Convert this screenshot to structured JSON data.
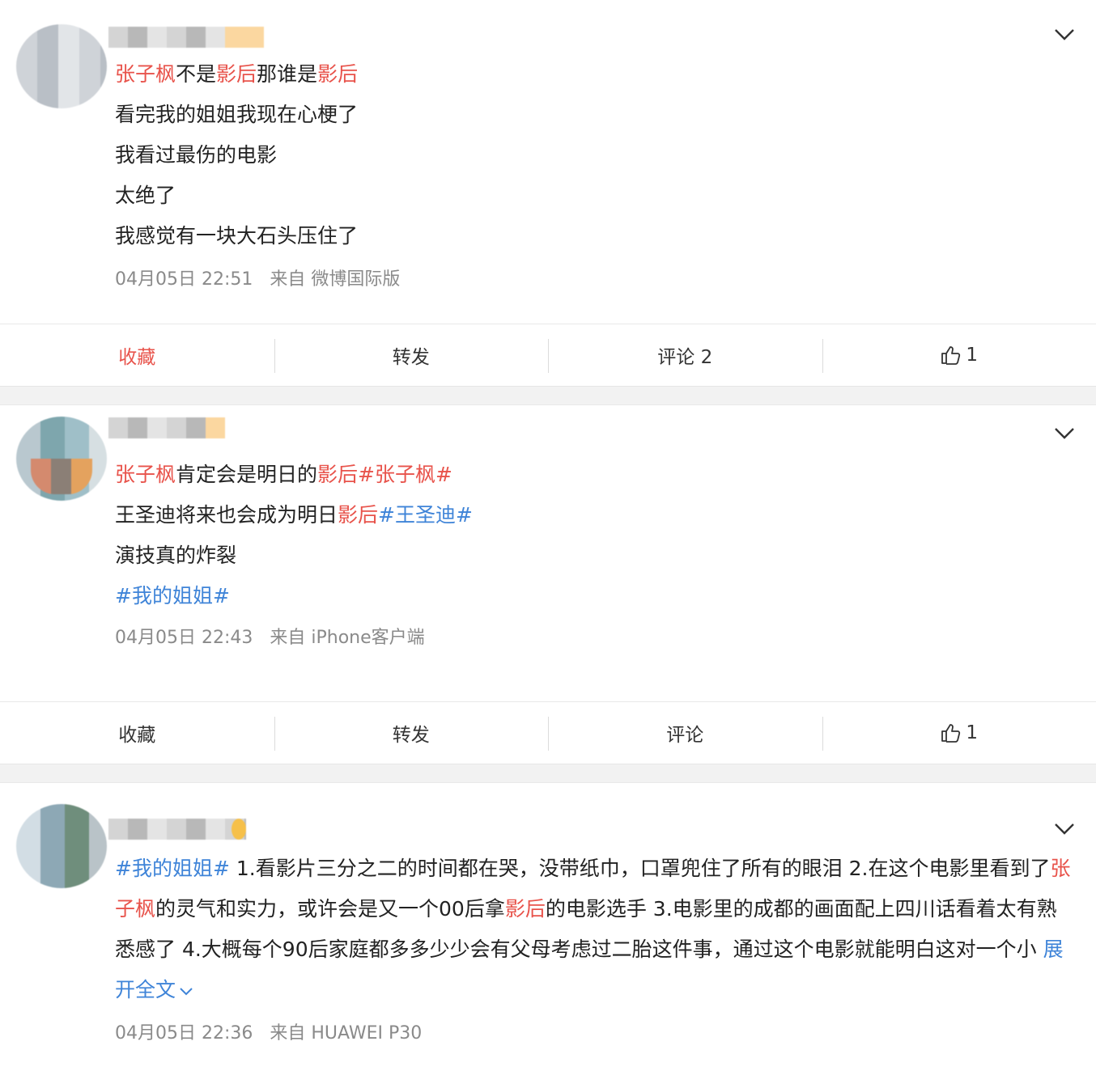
{
  "posts": [
    {
      "lines": [
        [
          {
            "t": "张子枫",
            "c": "red"
          },
          {
            "t": "不是"
          },
          {
            "t": "影后",
            "c": "red"
          },
          {
            "t": "那谁是"
          },
          {
            "t": "影后",
            "c": "red"
          }
        ],
        [
          {
            "t": "看完我的姐姐我现在心梗了"
          }
        ],
        [
          {
            "t": "我看过最伤的电影"
          }
        ],
        [
          {
            "t": "太绝了"
          }
        ],
        [
          {
            "t": "我感觉有一块大石头压住了"
          }
        ]
      ],
      "date": "04月05日 22:51",
      "source": "来自 微博国际版",
      "actions": {
        "favorite": "收藏",
        "repost": "转发",
        "comment": "评论 2",
        "like_count": "1"
      }
    },
    {
      "lines": [
        [
          {
            "t": "张子枫",
            "c": "red"
          },
          {
            "t": "肯定会是明日的"
          },
          {
            "t": "影后",
            "c": "red"
          },
          {
            "t": "#张子枫#",
            "c": "red"
          }
        ],
        [
          {
            "t": "王圣迪将来也会成为明日"
          },
          {
            "t": "影后",
            "c": "red"
          },
          {
            "t": "#王圣迪#",
            "c": "blue"
          }
        ],
        [
          {
            "t": "演技真的炸裂"
          }
        ],
        [
          {
            "t": "#我的姐姐#",
            "c": "blue"
          }
        ]
      ],
      "date": "04月05日 22:43",
      "source": "来自 iPhone客户端",
      "actions": {
        "favorite": "收藏",
        "repost": "转发",
        "comment": "评论",
        "like_count": "1"
      }
    },
    {
      "lines": [
        [
          {
            "t": "#我的姐姐#",
            "c": "blue"
          },
          {
            "t": " 1.看影片三分之二的时间都在哭，没带纸巾，口罩兜住了所有的眼泪 2.在这个电影里看到了"
          },
          {
            "t": "张子枫",
            "c": "red"
          },
          {
            "t": "的灵气和实力，或许会是又一个00后拿"
          },
          {
            "t": "影后",
            "c": "red"
          },
          {
            "t": "的电影选手 3.电影里的成都的画面配上四川话看着太有熟悉感了 4.大概每个90后家庭都多多少少会有父母考虑过二胎这件事，通过这个电影就能明白这对一个小 "
          }
        ]
      ],
      "expand": "展开全文",
      "date": "04月05日 22:36",
      "source": "来自 HUAWEI P30"
    }
  ],
  "colors": {
    "highlight_red": "#e8534b",
    "link_blue": "#3f84d8",
    "meta_gray": "#8a8a8a"
  },
  "icons": [
    "chevron-down-icon",
    "thumbs-up-icon"
  ]
}
